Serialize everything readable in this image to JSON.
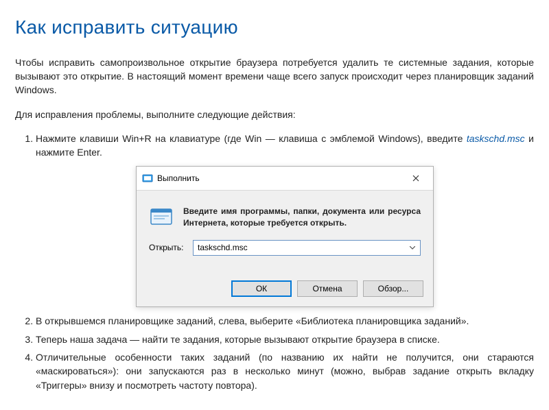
{
  "heading": "Как исправить ситуацию",
  "intro": "Чтобы исправить самопроизвольное открытие браузера потребуется удалить те системные задания, которые вызывают это открытие. В настоящий момент времени чаще всего запуск происходит через планировщик заданий Windows.",
  "lead": "Для исправления проблемы, выполните следующие действия:",
  "steps": {
    "s1_pre": "Нажмите клавиши Win+R на клавиатуре (где Win — клавиша с эмблемой Windows), введите ",
    "s1_cmd": "taskschd.msc",
    "s1_post": " и нажмите Enter.",
    "s2": "В открывшемся планировщике заданий, слева, выберите «Библиотека планировщика заданий».",
    "s3": "Теперь наша задача — найти те задания, которые вызывают открытие браузера в списке.",
    "s4": "Отличительные особенности таких заданий (по названию их найти не получится, они стараются «маскироваться»): они запускаются раз в несколько минут (можно, выбрав задание открыть вкладку «Триггеры» внизу и посмотреть частоту повтора)."
  },
  "dialog": {
    "title": "Выполнить",
    "desc": "Введите имя программы, папки, документа или ресурса Интернета, которые требуется открыть.",
    "open_label": "Открыть:",
    "open_value": "taskschd.msc",
    "btn_ok": "ОК",
    "btn_cancel": "Отмена",
    "btn_browse": "Обзор..."
  }
}
